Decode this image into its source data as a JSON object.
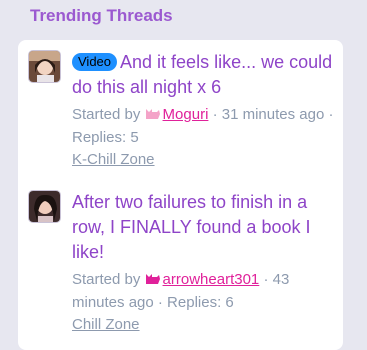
{
  "section": {
    "title": "Trending Threads"
  },
  "threads": [
    {
      "badge": "Video",
      "title": "And it feels like... we could do this all night x 6",
      "started_by": "Started by",
      "user": "Moguri",
      "user_icon": "cat-icon",
      "user_icon_color": "#f4a3c8",
      "time": "· 31 minutes ago",
      "replies": "· Replies: 5",
      "forum": "K-Chill Zone",
      "avatar_icon": "user-avatar"
    },
    {
      "badge": "",
      "title": "After two failures to finish in a row, I FINALLY found a book I like!",
      "started_by": "Started by",
      "user": "arrowheart301",
      "user_icon": "cat-icon",
      "user_icon_color": "#e0219a",
      "time": "· 43 minutes ago",
      "replies": "· Replies: 6",
      "forum": "Chill Zone",
      "avatar_icon": "user-avatar"
    }
  ],
  "colors": {
    "title": "#8e44c8",
    "heading": "#9b59d0",
    "meta": "#8d9aae",
    "user_link": "#e0219a",
    "badge": "#1e90ff"
  }
}
